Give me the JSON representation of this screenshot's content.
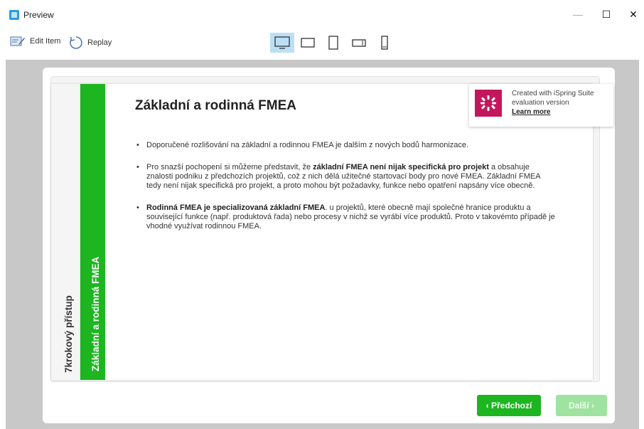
{
  "window": {
    "title": "Preview",
    "min": "—",
    "max": "☐",
    "close": "✕"
  },
  "toolbar": {
    "edit_label": "Edit Item",
    "replay_label": "Replay"
  },
  "slide": {
    "side_tab_inactive": "7krokový přístup",
    "side_tab_active": "Základní a rodinná FMEA",
    "title": "Základní a rodinná FMEA",
    "b1": "Doporučené rozlišování na základní a rodinnou FMEA je dalším z nových bodů harmonizace.",
    "b2_pre": "Pro snazší pochopení si můžeme představit, že ",
    "b2_bold": "základní FMEA není nijak specifická pro projekt",
    "b2_post": " a obsahuje znalosti podniku z předchozích projektů, což z nich dělá užitečné startovací body pro nové FMEA. Základní FMEA tedy není nijak specifická pro projekt, a proto mohou být požadavky, funkce nebo opatření napsány více obecně.",
    "b3_bold": "Rodinná FMEA je specializovaná základní FMEA",
    "b3_post": ". u projektů, které obecně mají společné hranice produktu a související funkce (např. produktová řada) nebo procesy v nichž se vyrábí více produktů. Proto v takovémto případě je vhodné využívat rodinnou FMEA."
  },
  "watermark": {
    "line1": "Created with iSpring Suite",
    "line2": "evaluation version",
    "link": "Learn more"
  },
  "nav": {
    "prev": "‹ Předchozí",
    "next": "Další ›"
  },
  "colors": {
    "accent_green": "#1db520",
    "watermark_logo": "#c2185b"
  }
}
